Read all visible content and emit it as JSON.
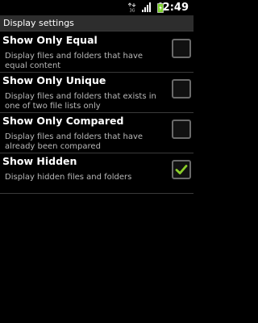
{
  "status_bar": {
    "network_label": "3G",
    "time": "2:49"
  },
  "title": "Display settings",
  "preferences": [
    {
      "title": "Show Only Equal",
      "summary": "Display files and folders that have equal content",
      "checked": false
    },
    {
      "title": "Show Only Unique",
      "summary": "Display files and folders that exists in one of two file lists only",
      "checked": false
    },
    {
      "title": "Show Only Compared",
      "summary": "Display files and folders that have already been compared",
      "checked": false
    },
    {
      "title": "Show Hidden",
      "summary": "Display hidden files and folders",
      "checked": true
    }
  ],
  "colors": {
    "check_mark": "#8ccf2a",
    "battery": "#7bd22b"
  }
}
